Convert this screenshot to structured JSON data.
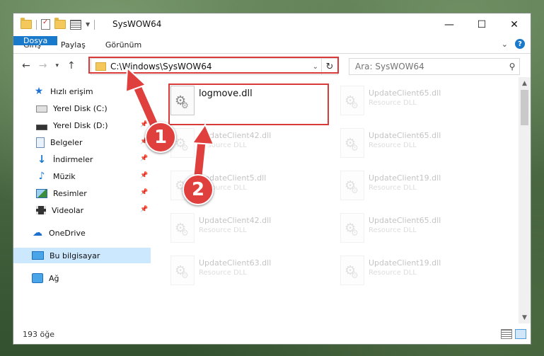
{
  "window": {
    "title": "SysWOW64",
    "controls": {
      "minimize": "—",
      "maximize": "☐",
      "close": "✕"
    }
  },
  "ribbon": {
    "tabs": [
      "Dosya",
      "Giriş",
      "Paylaş",
      "Görünüm"
    ],
    "help": "?"
  },
  "nav": {
    "address": "C:\\Windows\\SysWOW64",
    "search_placeholder": "Ara: SysWOW64"
  },
  "sidebar": {
    "items": [
      {
        "label": "Hızlı erişim",
        "icon": "star-icon"
      },
      {
        "label": "Yerel Disk (C:)",
        "icon": "drive-icon",
        "pinned": true
      },
      {
        "label": "Yerel Disk (D:)",
        "icon": "drive-icon",
        "pinned": true
      },
      {
        "label": "Belgeler",
        "icon": "documents-icon",
        "pinned": true
      },
      {
        "label": "İndirmeler",
        "icon": "download-icon",
        "pinned": true
      },
      {
        "label": "Müzik",
        "icon": "music-icon",
        "pinned": true
      },
      {
        "label": "Resimler",
        "icon": "pictures-icon",
        "pinned": true
      },
      {
        "label": "Videolar",
        "icon": "videos-icon",
        "pinned": true
      },
      {
        "label": "OneDrive",
        "icon": "cloud-icon"
      },
      {
        "label": "Bu bilgisayar",
        "icon": "computer-icon",
        "selected": true
      },
      {
        "label": "Ağ",
        "icon": "network-icon"
      }
    ]
  },
  "files": [
    {
      "name": "logmove.dll",
      "type": ""
    },
    {
      "name": "UpdateClient65.dll",
      "type": "Resource DLL"
    },
    {
      "name": "UpdateClient42.dll",
      "type": "Resource DLL"
    },
    {
      "name": "UpdateClient65.dll",
      "type": "Resource DLL"
    },
    {
      "name": "UpdateClient5.dll",
      "type": "Resource DLL"
    },
    {
      "name": "UpdateClient19.dll",
      "type": "Resource DLL"
    },
    {
      "name": "UpdateClient42.dll",
      "type": "Resource DLL"
    },
    {
      "name": "UpdateClient65.dll",
      "type": "Resource DLL"
    },
    {
      "name": "UpdateClient63.dll",
      "type": "Resource DLL"
    },
    {
      "name": "UpdateClient19.dll",
      "type": "Resource DLL"
    }
  ],
  "status": {
    "count": "193 öğe"
  },
  "annotations": {
    "step1": "1",
    "step2": "2"
  },
  "colors": {
    "accent": "#1979ca",
    "highlight": "#d83a3a",
    "selection": "#cce8ff"
  }
}
